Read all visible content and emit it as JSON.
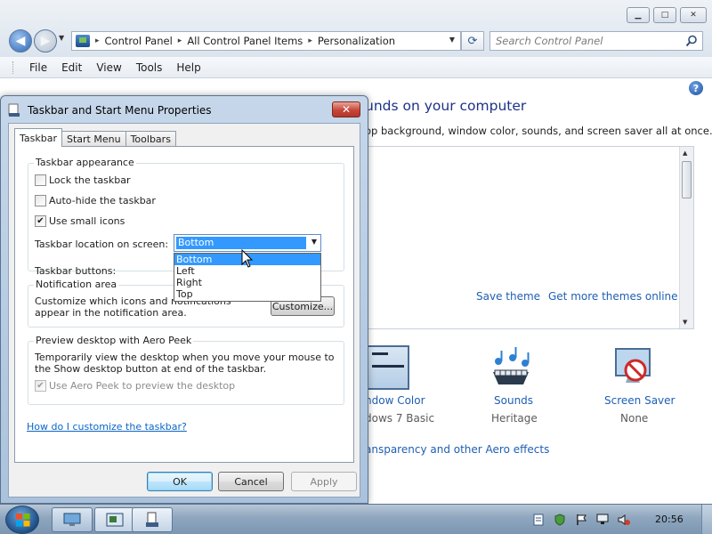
{
  "window": {
    "address": {
      "crumbs": [
        "Control Panel",
        "All Control Panel Items",
        "Personalization"
      ],
      "separator": "▸"
    },
    "search": {
      "placeholder": "Search Control Panel"
    },
    "menu": [
      "File",
      "Edit",
      "View",
      "Tools",
      "Help"
    ],
    "heading": "unds on your computer",
    "description": "op background, window color, sounds, and screen saver all at once.",
    "theme_links": [
      "Save theme",
      "Get more themes online"
    ],
    "tiles": [
      {
        "label": "ndow Color",
        "sub": "dows 7 Basic"
      },
      {
        "label": "Sounds",
        "sub": "Heritage"
      },
      {
        "label": "Screen Saver",
        "sub": "None"
      }
    ],
    "aero_link": "ansparency and other Aero effects"
  },
  "dialog": {
    "title": "Taskbar and Start Menu Properties",
    "close_glyph": "✕",
    "tabs": [
      "Taskbar",
      "Start Menu",
      "Toolbars"
    ],
    "appearance": {
      "title": "Taskbar appearance",
      "lock": {
        "label": "Lock the taskbar",
        "checked": false
      },
      "autohide": {
        "label": "Auto-hide the taskbar",
        "checked": false
      },
      "small_icons": {
        "label": "Use small icons",
        "checked": true
      },
      "location_label": "Taskbar location on screen:",
      "location_value": "Bottom",
      "location_options": [
        "Bottom",
        "Left",
        "Right",
        "Top"
      ],
      "buttons_label": "Taskbar buttons:"
    },
    "notification": {
      "title": "Notification area",
      "text": "Customize which icons and notifications appear in the notification area.",
      "button": "Customize..."
    },
    "peek": {
      "title": "Preview desktop with Aero Peek",
      "text": "Temporarily view the desktop when you move your mouse to the Show desktop button at end of the taskbar.",
      "checkbox": {
        "label": "Use Aero Peek to preview the desktop",
        "checked": true,
        "disabled": true
      }
    },
    "help_link": "How do I customize the taskbar?",
    "buttons": {
      "ok": "OK",
      "cancel": "Cancel",
      "apply": "Apply"
    }
  },
  "taskbar": {
    "clock": "20:56"
  }
}
